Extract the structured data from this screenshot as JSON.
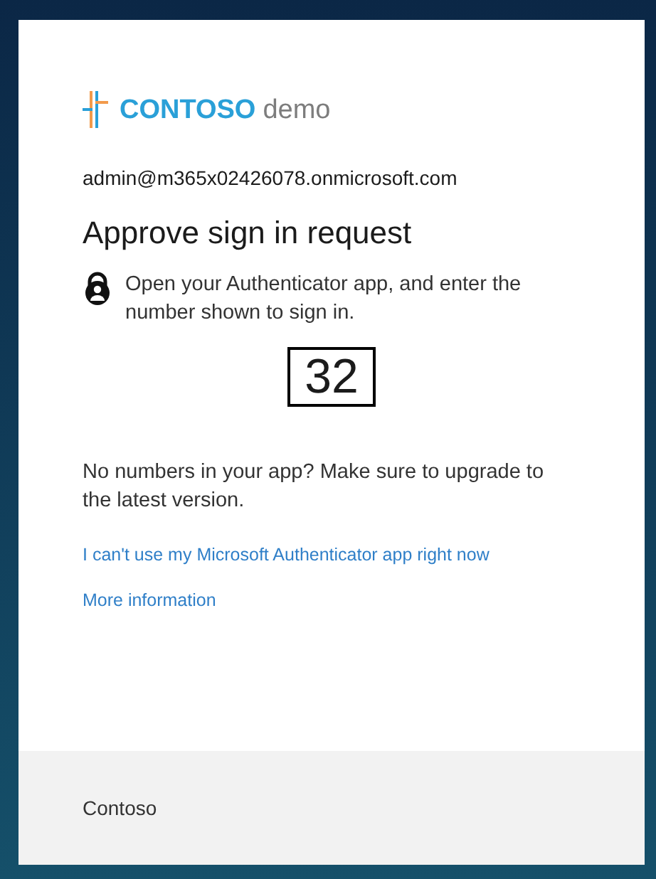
{
  "logo": {
    "brand": "CONTOSO",
    "suffix": "demo"
  },
  "account": "admin@m365x02426078.onmicrosoft.com",
  "title": "Approve sign in request",
  "instruction": "Open your Authenticator app, and enter the number shown to sign in.",
  "number": "32",
  "note": "No numbers in your app? Make sure to upgrade to the latest version.",
  "links": [
    "I can't use my Microsoft Authenticator app right now",
    "More information"
  ],
  "footer": "Contoso"
}
